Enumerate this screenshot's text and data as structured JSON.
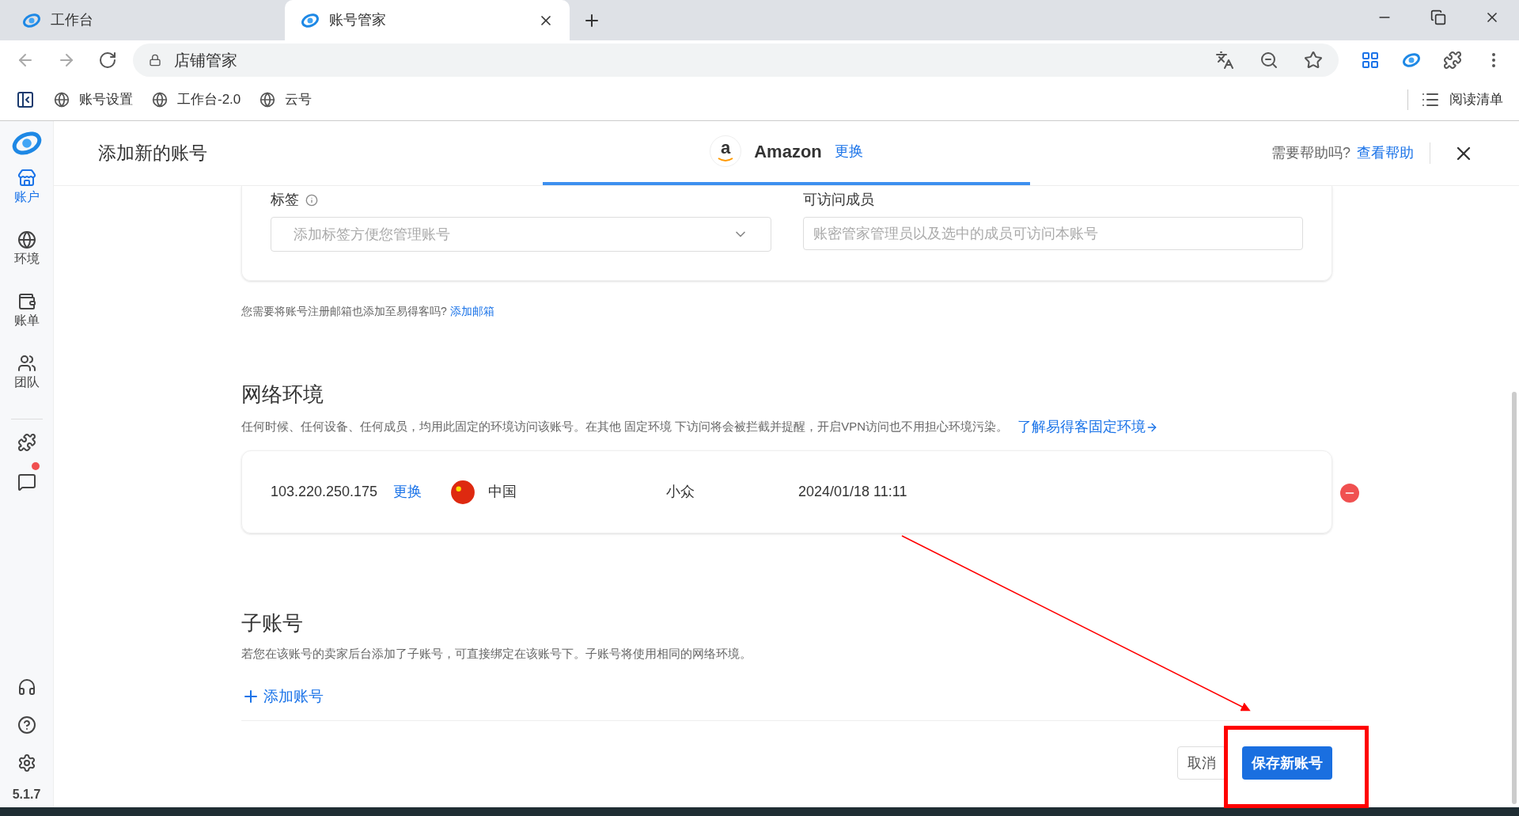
{
  "browser": {
    "tabs": [
      {
        "label": "工作台",
        "selected": false
      },
      {
        "label": "账号管家",
        "selected": true
      }
    ],
    "address": "店铺管家",
    "bookmarks": [
      "账号设置",
      "工作台-2.0",
      "云号"
    ],
    "reading_list": "阅读清单"
  },
  "sidebar": {
    "nav": [
      {
        "label": "账户",
        "kind": "store",
        "selected": true
      },
      {
        "label": "环境",
        "kind": "globe",
        "selected": false
      },
      {
        "label": "账单",
        "kind": "wallet",
        "selected": false
      },
      {
        "label": "团队",
        "kind": "team",
        "selected": false
      }
    ],
    "tools": [
      {
        "kind": "puzzle",
        "unread": false
      },
      {
        "kind": "chat",
        "unread": true
      }
    ],
    "version": "5.1.7"
  },
  "header": {
    "title": "添加新的账号",
    "logo_letter": "a",
    "platform": "Amazon",
    "change": "更换",
    "help_prompt": "需要帮助吗?",
    "help_link": "查看帮助"
  },
  "form": {
    "tags_label": "标签",
    "tags_placeholder": "添加标签方便您管理账号",
    "members_label": "可访问成员",
    "members_placeholder": "账密管家管理员以及选中的成员可访问本账号",
    "email_note": "您需要将账号注册邮箱也添加至易得客吗?",
    "email_link": "添加邮箱"
  },
  "network": {
    "heading": "网络环境",
    "description": "任何时候、任何设备、任何成员，均用此固定的环境访问该账号。在其他 固定环境 下访问将会被拦截并提醒，开启VPN访问也不用担心环境污染。",
    "link": "了解易得客固定环境",
    "row": {
      "ip": "103.220.250.175",
      "change": "更换",
      "country": "中国",
      "type": "小众",
      "date": "2024/01/18 11:11"
    }
  },
  "sub_accounts": {
    "heading": "子账号",
    "description": "若您在该账号的卖家后台添加了子账号，可直接绑定在该账号下。子账号将使用相同的网络环境。",
    "add": "添加账号"
  },
  "footer": {
    "cancel": "取消",
    "save": "保存新账号"
  }
}
